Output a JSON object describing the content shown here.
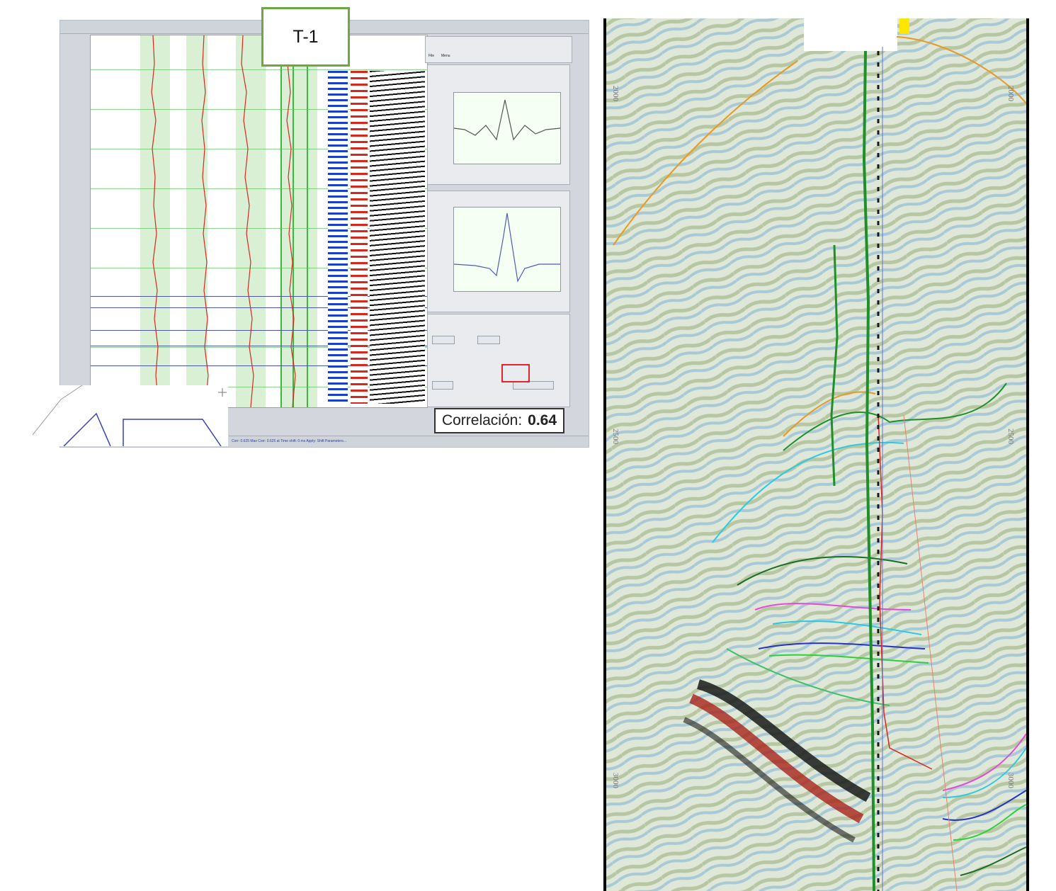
{
  "well_label": "T-1",
  "correlation": {
    "label": "Correlación:",
    "value": "0.64"
  },
  "software_window": {
    "tabs": [
      "File",
      "Menu"
    ],
    "bottom_status": "Corr: 0.625 Max Corr: 0.625 at Time shift: 0 ms Apply: Shift Parameters..."
  },
  "seismic": {
    "depth_labels_left": [
      "2000",
      "2500",
      "3000"
    ],
    "depth_labels_right": [
      "2000",
      "2500",
      "3000"
    ]
  },
  "colors": {
    "t1_border": "#6ea744",
    "log_curve": "#d8281e",
    "green_wells": "#1f8f2a",
    "horizon_orange": "#e59a27",
    "horizon_cyan": "#2dc9e3",
    "horizon_magenta": "#e44bd5",
    "horizon_blue": "#2433c9",
    "horizon_darkgreen": "#1b6d24",
    "seismic_red": "#a8231b",
    "seismic_black": "#1a1a1a",
    "highlight_box": "#e0262b",
    "yellow_marker": "#ffe600"
  }
}
